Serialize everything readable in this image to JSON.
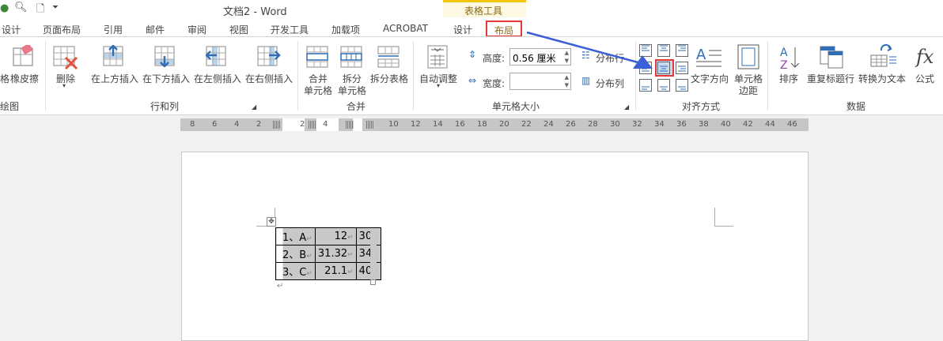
{
  "title": "文档2 - Word",
  "context_tab_group": "表格工具",
  "tabs": [
    "设计",
    "页面布局",
    "引用",
    "邮件",
    "审阅",
    "视图",
    "开发工具",
    "加载项",
    "ACROBAT",
    "设计",
    "布局"
  ],
  "active_tab": "布局",
  "ribbon": {
    "draw": {
      "items": [
        "格",
        "橡皮擦"
      ],
      "group": "绘图"
    },
    "rows_cols": {
      "delete": "删除",
      "insert_above": "在上方插入",
      "insert_below": "在下方插入",
      "insert_left": "在左侧插入",
      "insert_right": "在右侧插入",
      "group": "行和列"
    },
    "merge": {
      "merge_l1": "合并",
      "merge_l2": "单元格",
      "split_l1": "拆分",
      "split_l2": "单元格",
      "split_table": "拆分表格",
      "group": "合并"
    },
    "cell_size": {
      "autofit": "自动调整",
      "height_label": "高度:",
      "height_value": "0.56 厘米",
      "width_label": "宽度:",
      "width_value": "",
      "dist_rows": "分布行",
      "dist_cols": "分布列",
      "group": "单元格大小"
    },
    "alignment": {
      "text_direction": "文字方向",
      "margins_l1": "单元格",
      "margins_l2": "边距",
      "group": "对齐方式",
      "selected": "center-center"
    },
    "data": {
      "sort": "排序",
      "repeat_header": "重复标题行",
      "convert_text": "转换为文本",
      "formula": "公式",
      "group": "数据"
    }
  },
  "ruler": [
    "8",
    "6",
    "4",
    "2",
    "2",
    "4",
    "10",
    "12",
    "14",
    "16",
    "18",
    "20",
    "22",
    "24",
    "26",
    "28",
    "30",
    "32",
    "34",
    "36",
    "38",
    "40",
    "42",
    "44",
    "46"
  ],
  "table": [
    [
      "1、A",
      "12",
      "30"
    ],
    [
      "2、B",
      "31.32",
      "34"
    ],
    [
      "3、C",
      "21.1",
      "40"
    ]
  ],
  "colors": {
    "highlight": "#e53935",
    "arrow": "#3b5fd6",
    "context": "#f1c40f"
  }
}
